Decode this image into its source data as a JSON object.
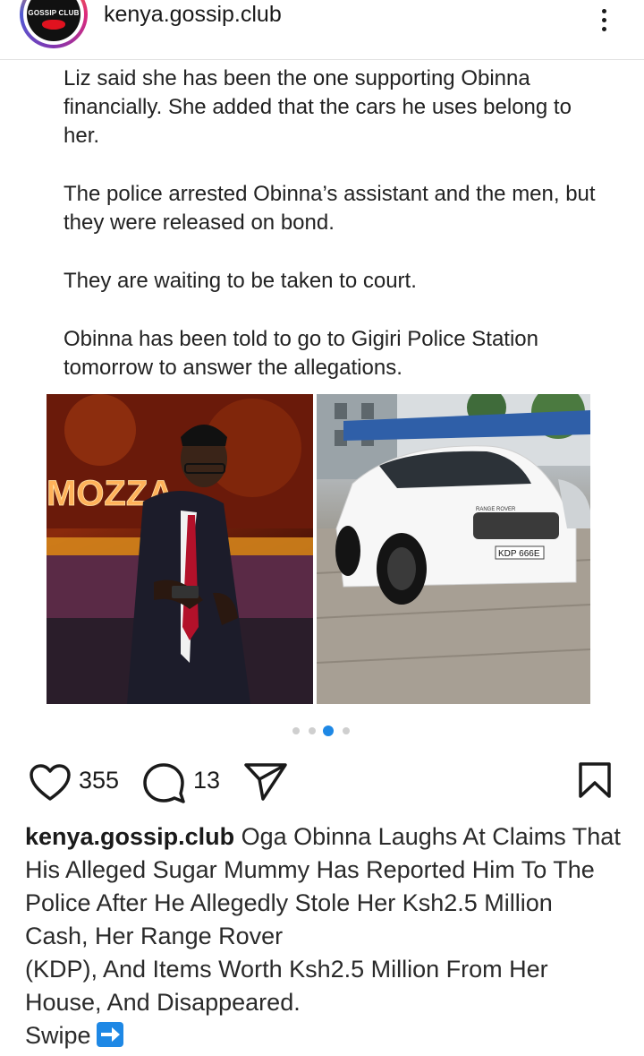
{
  "header": {
    "avatar_brand": "GOSSIP CLUB",
    "username": "kenya.gossip.club"
  },
  "article": {
    "paragraphs": [
      "Liz said she has been the one supporting Obinna financially. She added that the cars he uses belong to her.",
      "The police arrested Obinna’s assistant and the men, but they were released on bond.",
      "They are waiting to be taken to court.",
      "Obinna has been told to go to Gigiri Police Station tomorrow to answer the allegations."
    ]
  },
  "photos": {
    "left_sign": "MOZZA",
    "car_badge": "RANGE ROVER",
    "car_plate": "KDP 666E"
  },
  "carousel": {
    "count": 4,
    "active_index": 2,
    "active_color": "#1e88e5"
  },
  "actions": {
    "likes": "355",
    "comments": "13"
  },
  "caption": {
    "username": "kenya.gossip.club",
    "lines": [
      " Oga Obinna Laughs At Claims That",
      "His Alleged Sugar Mummy Has Reported Him To The",
      "Police After He Allegedly Stole Her Ksh2.5 Million",
      "Cash, Her Range Rover",
      "(KDP), And Items Worth Ksh2.5 Million From Her",
      "House, And Disappeared."
    ],
    "swipe": "Swipe"
  },
  "icons": {
    "more": "more-vertical-icon",
    "like": "heart-icon",
    "comment": "comment-icon",
    "share": "send-icon",
    "save": "bookmark-icon",
    "swipe_arrow": "right-arrow-emoji"
  }
}
